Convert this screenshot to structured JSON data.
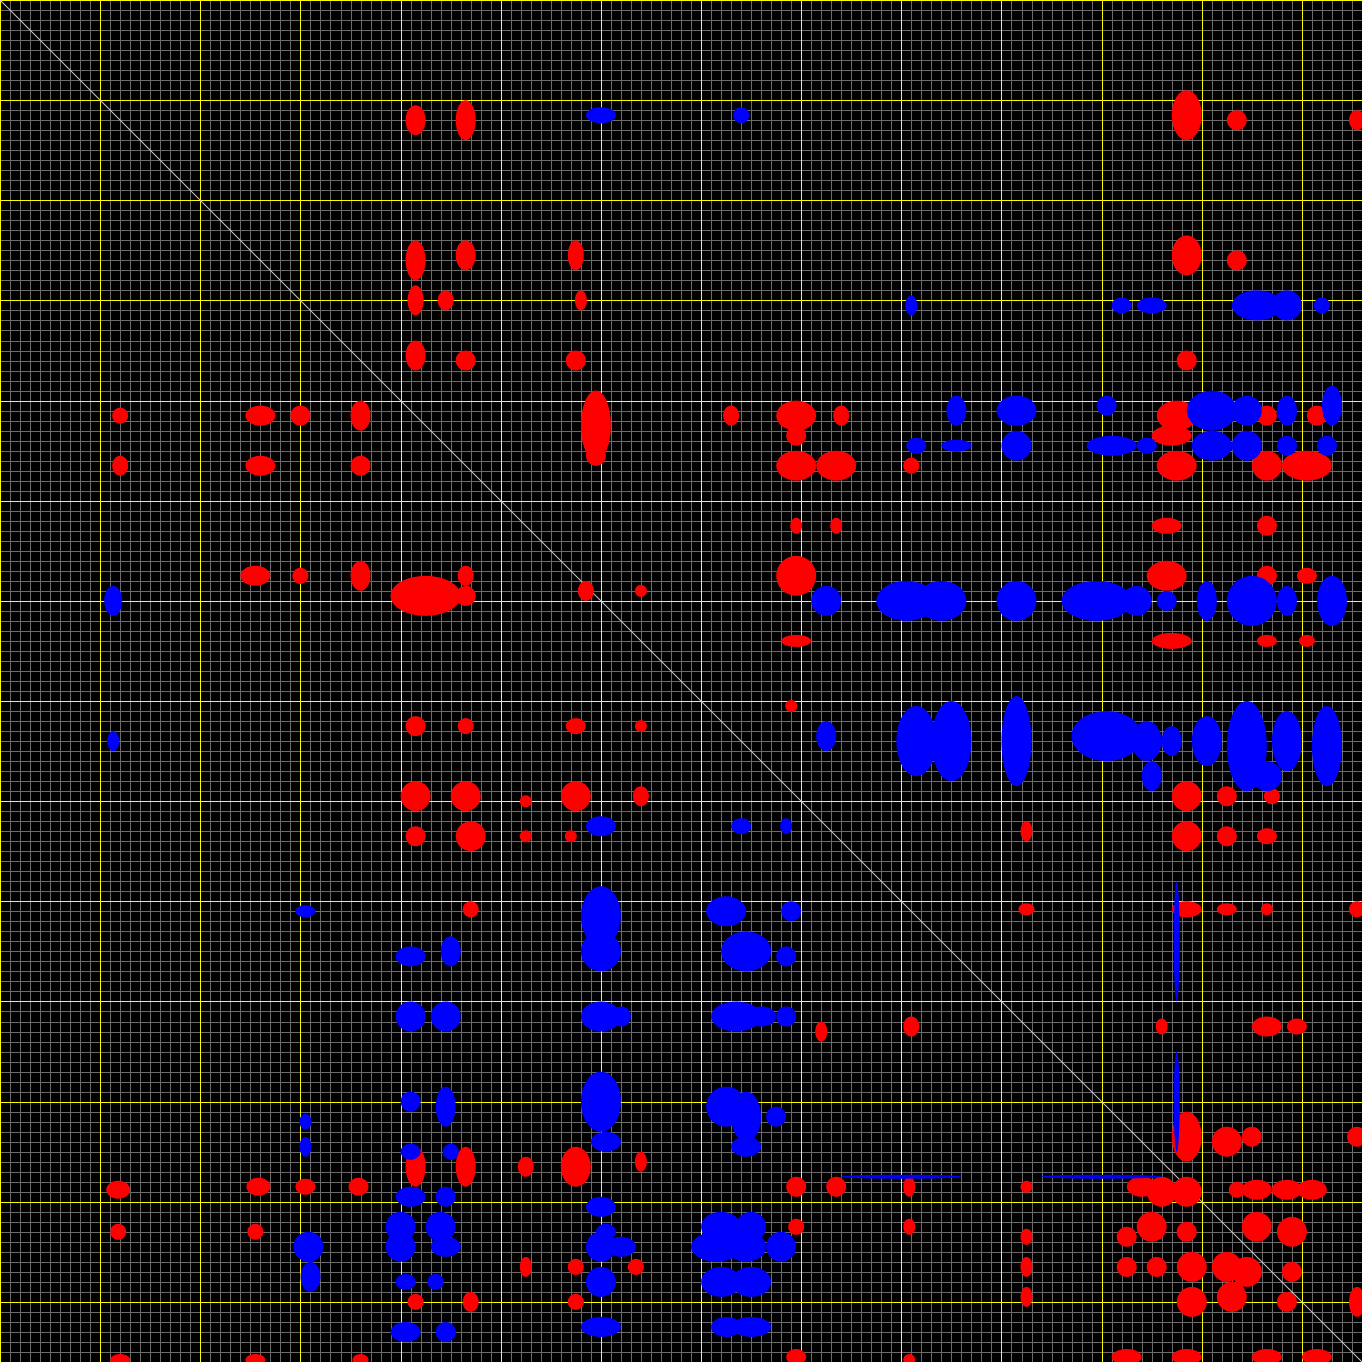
{
  "map": {
    "bins": 136,
    "diagonal": true,
    "grid": {
      "minor_every": 1,
      "major_every": 10
    },
    "colors": {
      "background": "#000000",
      "minor_grid": "#6b6b6b",
      "major_grid": "#ffff00",
      "diagonal": "#c8c8c8",
      "positive": "#ff0000",
      "negative": "#0000ff"
    }
  },
  "blocks": {
    "positive": [
      [
        46.5,
        12.0,
        1.0,
        2.0
      ],
      [
        41.5,
        12.0,
        1.0,
        1.5
      ],
      [
        118.5,
        11.5,
        1.5,
        2.5
      ],
      [
        123.5,
        12.0,
        1.0,
        1.0
      ],
      [
        135.5,
        12.0,
        0.8,
        1.0
      ],
      [
        41.5,
        26.0,
        1.0,
        2.0
      ],
      [
        46.5,
        25.5,
        1.0,
        1.5
      ],
      [
        57.5,
        25.5,
        0.8,
        1.5
      ],
      [
        118.5,
        25.5,
        1.5,
        2.0
      ],
      [
        123.5,
        26.0,
        1.0,
        1.0
      ],
      [
        41.5,
        30.0,
        0.8,
        1.5
      ],
      [
        44.5,
        30.0,
        0.8,
        1.0
      ],
      [
        58.0,
        30.0,
        0.6,
        1.0
      ],
      [
        41.5,
        35.5,
        1.0,
        1.5
      ],
      [
        46.5,
        36.0,
        1.0,
        1.0
      ],
      [
        57.5,
        36.0,
        1.0,
        1.0
      ],
      [
        118.5,
        36.0,
        1.0,
        1.0
      ],
      [
        12.0,
        41.5,
        0.8,
        0.8
      ],
      [
        26.0,
        41.5,
        1.5,
        1.0
      ],
      [
        30.0,
        41.5,
        1.0,
        1.0
      ],
      [
        36.0,
        41.5,
        1.0,
        1.5
      ],
      [
        59.5,
        42.5,
        1.5,
        3.5
      ],
      [
        73.0,
        41.5,
        0.8,
        1.0
      ],
      [
        79.5,
        41.5,
        2.0,
        1.5
      ],
      [
        84.0,
        41.5,
        0.8,
        1.0
      ],
      [
        117.5,
        41.5,
        2.0,
        1.5
      ],
      [
        122.0,
        41.5,
        1.0,
        1.0
      ],
      [
        126.5,
        41.5,
        1.0,
        1.0
      ],
      [
        131.5,
        41.5,
        1.0,
        1.0
      ],
      [
        79.5,
        43.5,
        1.0,
        1.0
      ],
      [
        117.0,
        43.5,
        2.0,
        1.0
      ],
      [
        12.0,
        46.5,
        0.8,
        1.0
      ],
      [
        26.0,
        46.5,
        1.5,
        1.0
      ],
      [
        36.0,
        46.5,
        1.0,
        1.0
      ],
      [
        59.5,
        45.5,
        1.0,
        1.0
      ],
      [
        79.5,
        46.5,
        2.0,
        1.5
      ],
      [
        83.5,
        46.5,
        2.0,
        1.5
      ],
      [
        91.0,
        46.5,
        0.8,
        0.8
      ],
      [
        117.5,
        46.5,
        2.0,
        1.5
      ],
      [
        126.5,
        46.5,
        1.5,
        1.5
      ],
      [
        130.5,
        46.5,
        2.5,
        1.5
      ],
      [
        79.5,
        52.5,
        0.6,
        0.8
      ],
      [
        83.5,
        52.5,
        0.6,
        0.8
      ],
      [
        116.5,
        52.5,
        1.5,
        0.8
      ],
      [
        126.5,
        52.5,
        1.0,
        1.0
      ],
      [
        25.5,
        57.5,
        1.5,
        1.0
      ],
      [
        36.0,
        57.5,
        1.0,
        1.5
      ],
      [
        30.0,
        57.5,
        0.8,
        0.8
      ],
      [
        46.5,
        57.5,
        0.8,
        1.0
      ],
      [
        79.5,
        57.5,
        2.0,
        2.0
      ],
      [
        116.5,
        57.5,
        2.0,
        1.5
      ],
      [
        126.5,
        57.5,
        1.0,
        1.0
      ],
      [
        130.5,
        57.5,
        1.0,
        0.8
      ],
      [
        42.5,
        59.5,
        3.5,
        2.0
      ],
      [
        46.5,
        59.5,
        1.0,
        1.0
      ],
      [
        58.5,
        59.0,
        0.8,
        1.0
      ],
      [
        64.0,
        59.0,
        0.6,
        0.6
      ],
      [
        79.5,
        64.0,
        1.5,
        0.6
      ],
      [
        117.0,
        64.0,
        2.0,
        0.8
      ],
      [
        126.5,
        64.0,
        1.0,
        0.6
      ],
      [
        130.5,
        64.0,
        0.8,
        0.6
      ],
      [
        41.5,
        72.5,
        1.0,
        1.0
      ],
      [
        46.5,
        72.5,
        0.8,
        0.8
      ],
      [
        57.5,
        72.5,
        1.0,
        0.8
      ],
      [
        64.0,
        72.5,
        0.6,
        0.6
      ],
      [
        79.0,
        70.5,
        0.6,
        0.6
      ],
      [
        41.5,
        79.5,
        1.5,
        1.5
      ],
      [
        46.5,
        79.5,
        1.5,
        1.5
      ],
      [
        57.5,
        79.5,
        1.5,
        1.5
      ],
      [
        64.0,
        79.5,
        0.8,
        1.0
      ],
      [
        52.5,
        80.0,
        0.6,
        0.6
      ],
      [
        118.5,
        79.5,
        1.5,
        1.5
      ],
      [
        122.5,
        79.5,
        1.0,
        1.0
      ],
      [
        127.0,
        79.5,
        0.8,
        0.8
      ],
      [
        41.5,
        83.5,
        1.0,
        1.0
      ],
      [
        47.0,
        83.5,
        1.5,
        1.5
      ],
      [
        52.5,
        83.5,
        0.6,
        0.6
      ],
      [
        57.0,
        83.5,
        0.6,
        0.6
      ],
      [
        118.5,
        83.5,
        1.5,
        1.5
      ],
      [
        122.5,
        83.5,
        1.0,
        1.0
      ],
      [
        126.5,
        83.5,
        1.0,
        0.8
      ],
      [
        102.5,
        83.0,
        0.6,
        1.0
      ],
      [
        47.0,
        90.8,
        0.8,
        0.8
      ],
      [
        102.5,
        90.8,
        0.8,
        0.6
      ],
      [
        118.5,
        90.8,
        1.5,
        0.8
      ],
      [
        122.5,
        90.8,
        1.0,
        0.6
      ],
      [
        126.5,
        90.8,
        0.6,
        0.6
      ],
      [
        135.5,
        90.8,
        0.8,
        0.8
      ],
      [
        82.0,
        103.0,
        0.6,
        1.0
      ],
      [
        91.0,
        102.5,
        0.8,
        1.0
      ],
      [
        116.0,
        102.5,
        0.6,
        0.8
      ],
      [
        126.5,
        102.5,
        1.5,
        1.0
      ],
      [
        129.5,
        102.5,
        1.0,
        0.8
      ],
      [
        41.5,
        116.5,
        1.0,
        2.0
      ],
      [
        46.5,
        116.5,
        1.0,
        2.0
      ],
      [
        52.5,
        116.5,
        0.8,
        1.0
      ],
      [
        57.5,
        116.5,
        1.5,
        2.0
      ],
      [
        64.0,
        116.0,
        0.6,
        1.0
      ],
      [
        118.5,
        113.5,
        1.5,
        2.5
      ],
      [
        122.5,
        114.0,
        1.5,
        1.5
      ],
      [
        125.0,
        113.5,
        1.0,
        1.0
      ],
      [
        135.5,
        113.5,
        1.0,
        1.0
      ],
      [
        11.8,
        118.8,
        1.2,
        0.9
      ],
      [
        25.8,
        118.5,
        1.2,
        0.9
      ],
      [
        30.5,
        118.5,
        1.0,
        0.8
      ],
      [
        35.8,
        118.5,
        1.0,
        0.9
      ],
      [
        79.5,
        118.5,
        1.0,
        1.0
      ],
      [
        83.5,
        118.5,
        1.0,
        1.0
      ],
      [
        90.8,
        118.5,
        0.6,
        1.0
      ],
      [
        102.5,
        118.5,
        0.6,
        0.6
      ],
      [
        114.0,
        118.5,
        1.5,
        1.0
      ],
      [
        116.0,
        119.0,
        1.5,
        1.5
      ],
      [
        118.5,
        119.0,
        1.5,
        1.5
      ],
      [
        123.5,
        118.8,
        0.8,
        0.8
      ],
      [
        125.5,
        118.8,
        1.5,
        1.0
      ],
      [
        128.5,
        118.8,
        1.5,
        1.0
      ],
      [
        131.0,
        118.8,
        1.5,
        1.0
      ],
      [
        11.8,
        123.0,
        0.8,
        0.8
      ],
      [
        25.5,
        123.0,
        0.8,
        0.8
      ],
      [
        79.5,
        122.5,
        0.8,
        0.8
      ],
      [
        90.8,
        122.5,
        0.6,
        0.8
      ],
      [
        102.5,
        123.5,
        0.6,
        0.8
      ],
      [
        112.5,
        123.5,
        1.0,
        1.0
      ],
      [
        115.0,
        122.5,
        1.5,
        1.5
      ],
      [
        118.5,
        123.0,
        1.0,
        1.0
      ],
      [
        125.5,
        122.5,
        1.5,
        1.5
      ],
      [
        129.0,
        123.0,
        1.5,
        1.5
      ],
      [
        52.5,
        126.5,
        0.6,
        1.0
      ],
      [
        57.5,
        126.5,
        0.8,
        0.8
      ],
      [
        63.5,
        126.5,
        0.8,
        0.8
      ],
      [
        102.5,
        126.5,
        0.6,
        1.0
      ],
      [
        112.5,
        126.5,
        1.0,
        1.0
      ],
      [
        115.5,
        126.5,
        1.0,
        1.0
      ],
      [
        119.0,
        126.5,
        1.5,
        1.5
      ],
      [
        122.5,
        126.5,
        1.5,
        1.5
      ],
      [
        124.5,
        127.0,
        1.5,
        1.5
      ],
      [
        129.0,
        127.0,
        1.0,
        1.0
      ],
      [
        41.5,
        130.0,
        0.8,
        0.8
      ],
      [
        47.0,
        130.0,
        0.8,
        1.0
      ],
      [
        57.5,
        130.0,
        0.8,
        0.8
      ],
      [
        102.5,
        129.5,
        0.6,
        1.0
      ],
      [
        119.0,
        130.0,
        1.5,
        1.5
      ],
      [
        123.0,
        129.5,
        1.5,
        1.5
      ],
      [
        128.5,
        130.0,
        1.0,
        1.0
      ],
      [
        135.5,
        130.0,
        0.8,
        1.5
      ],
      [
        12.0,
        135.8,
        1.0,
        0.6
      ],
      [
        25.5,
        135.8,
        1.0,
        0.6
      ],
      [
        36.0,
        135.8,
        0.8,
        0.6
      ],
      [
        79.5,
        135.5,
        1.0,
        0.8
      ],
      [
        90.8,
        135.8,
        0.6,
        0.6
      ],
      [
        112.5,
        135.5,
        1.5,
        0.8
      ],
      [
        118.5,
        135.5,
        1.5,
        0.8
      ],
      [
        126.5,
        135.5,
        1.5,
        0.8
      ],
      [
        131.5,
        135.5,
        1.5,
        0.8
      ]
    ],
    "negative": [
      [
        60.0,
        11.5,
        1.5,
        0.8
      ],
      [
        74.0,
        11.5,
        0.8,
        0.8
      ],
      [
        91.0,
        30.5,
        0.6,
        1.0
      ],
      [
        112.0,
        30.5,
        1.0,
        0.8
      ],
      [
        115.0,
        30.5,
        1.5,
        0.8
      ],
      [
        125.5,
        30.5,
        2.5,
        1.5
      ],
      [
        128.5,
        30.5,
        1.5,
        1.5
      ],
      [
        132.0,
        30.5,
        0.8,
        0.8
      ],
      [
        95.5,
        41.0,
        1.0,
        1.5
      ],
      [
        101.5,
        41.0,
        2.0,
        1.5
      ],
      [
        110.5,
        40.5,
        1.0,
        1.0
      ],
      [
        121.0,
        41.0,
        2.5,
        2.0
      ],
      [
        124.5,
        41.0,
        1.5,
        1.5
      ],
      [
        128.5,
        41.0,
        1.0,
        1.5
      ],
      [
        133.0,
        40.5,
        1.0,
        2.0
      ],
      [
        91.5,
        44.5,
        1.0,
        0.8
      ],
      [
        95.5,
        44.5,
        1.5,
        0.6
      ],
      [
        101.5,
        44.5,
        1.5,
        1.5
      ],
      [
        111.0,
        44.5,
        2.5,
        1.0
      ],
      [
        114.5,
        44.5,
        1.0,
        0.8
      ],
      [
        121.0,
        44.5,
        2.0,
        1.5
      ],
      [
        124.5,
        44.5,
        1.5,
        1.5
      ],
      [
        128.5,
        44.5,
        1.0,
        1.0
      ],
      [
        132.5,
        44.5,
        1.0,
        1.0
      ],
      [
        11.3,
        60.0,
        0.9,
        1.5
      ],
      [
        82.5,
        60.0,
        1.5,
        1.5
      ],
      [
        90.5,
        60.0,
        3.0,
        2.0
      ],
      [
        94.0,
        60.0,
        2.5,
        2.0
      ],
      [
        101.5,
        60.0,
        2.0,
        2.0
      ],
      [
        109.5,
        60.0,
        3.5,
        2.0
      ],
      [
        113.5,
        60.0,
        1.5,
        1.5
      ],
      [
        116.5,
        60.0,
        1.0,
        1.0
      ],
      [
        120.5,
        60.0,
        1.0,
        2.0
      ],
      [
        125.0,
        60.0,
        2.5,
        2.5
      ],
      [
        128.5,
        60.0,
        1.0,
        1.5
      ],
      [
        133.0,
        60.0,
        1.5,
        2.5
      ],
      [
        11.3,
        74.0,
        0.6,
        1.0
      ],
      [
        82.5,
        73.5,
        1.0,
        1.5
      ],
      [
        91.5,
        74.0,
        2.0,
        3.5
      ],
      [
        95.0,
        74.0,
        2.0,
        4.0
      ],
      [
        101.5,
        74.0,
        1.5,
        4.5
      ],
      [
        110.5,
        73.5,
        3.5,
        2.5
      ],
      [
        114.5,
        74.0,
        1.5,
        2.0
      ],
      [
        117.0,
        74.0,
        1.0,
        1.5
      ],
      [
        120.5,
        74.0,
        1.5,
        2.5
      ],
      [
        124.5,
        74.5,
        2.0,
        4.5
      ],
      [
        128.5,
        74.0,
        1.5,
        3.0
      ],
      [
        132.5,
        74.5,
        1.5,
        4.0
      ],
      [
        115.0,
        77.5,
        1.0,
        1.5
      ],
      [
        126.5,
        77.5,
        1.5,
        1.5
      ],
      [
        60.0,
        82.5,
        1.5,
        1.0
      ],
      [
        74.0,
        82.5,
        1.0,
        0.8
      ],
      [
        78.5,
        82.5,
        0.6,
        0.8
      ],
      [
        30.5,
        91.0,
        1.0,
        0.6
      ],
      [
        41.0,
        95.5,
        1.5,
        1.0
      ],
      [
        45.0,
        95.0,
        1.0,
        1.5
      ],
      [
        60.0,
        91.5,
        2.0,
        3.0
      ],
      [
        60.0,
        95.0,
        2.0,
        2.0
      ],
      [
        72.5,
        91.0,
        2.0,
        1.5
      ],
      [
        74.5,
        95.0,
        2.5,
        2.0
      ],
      [
        79.0,
        91.0,
        1.0,
        1.0
      ],
      [
        78.5,
        95.5,
        1.0,
        1.0
      ],
      [
        41.0,
        101.5,
        1.5,
        1.5
      ],
      [
        44.5,
        101.5,
        1.5,
        1.5
      ],
      [
        60.0,
        101.5,
        2.0,
        1.5
      ],
      [
        62.0,
        101.5,
        1.0,
        1.0
      ],
      [
        73.5,
        101.5,
        2.5,
        1.5
      ],
      [
        76.0,
        101.5,
        1.5,
        1.0
      ],
      [
        78.5,
        101.5,
        1.0,
        1.0
      ],
      [
        30.5,
        112.0,
        0.6,
        0.8
      ],
      [
        41.0,
        110.0,
        1.0,
        1.0
      ],
      [
        44.5,
        110.5,
        1.0,
        2.0
      ],
      [
        60.0,
        110.0,
        2.0,
        3.0
      ],
      [
        60.5,
        114.0,
        1.5,
        1.0
      ],
      [
        72.5,
        110.5,
        2.0,
        2.0
      ],
      [
        74.5,
        111.5,
        1.5,
        2.5
      ],
      [
        77.5,
        111.5,
        1.0,
        1.0
      ],
      [
        74.5,
        114.5,
        1.5,
        1.0
      ],
      [
        30.5,
        114.5,
        0.6,
        1.0
      ],
      [
        41.0,
        115.0,
        1.0,
        0.8
      ],
      [
        45.0,
        115.0,
        0.8,
        0.8
      ],
      [
        41.0,
        119.5,
        1.5,
        1.0
      ],
      [
        44.5,
        119.5,
        1.0,
        1.0
      ],
      [
        60.0,
        120.5,
        1.5,
        1.0
      ],
      [
        60.5,
        123.0,
        1.0,
        0.8
      ],
      [
        40.0,
        122.5,
        1.5,
        1.5
      ],
      [
        44.0,
        122.5,
        1.5,
        1.5
      ],
      [
        72.0,
        122.5,
        2.0,
        1.5
      ],
      [
        75.0,
        122.5,
        1.5,
        1.5
      ],
      [
        30.8,
        124.5,
        1.5,
        1.5
      ],
      [
        40.0,
        124.5,
        1.5,
        1.5
      ],
      [
        44.5,
        124.5,
        1.5,
        1.0
      ],
      [
        60.0,
        124.5,
        1.5,
        1.5
      ],
      [
        62.0,
        124.5,
        1.5,
        1.0
      ],
      [
        71.5,
        124.5,
        2.5,
        1.5
      ],
      [
        74.5,
        124.5,
        2.0,
        1.5
      ],
      [
        78.0,
        124.5,
        1.5,
        1.5
      ],
      [
        31.0,
        127.5,
        1.0,
        1.5
      ],
      [
        40.5,
        128.0,
        1.0,
        0.8
      ],
      [
        43.5,
        128.0,
        0.8,
        0.8
      ],
      [
        60.0,
        128.0,
        1.5,
        1.5
      ],
      [
        72.0,
        128.0,
        2.0,
        1.5
      ],
      [
        75.0,
        128.0,
        2.0,
        1.5
      ],
      [
        40.5,
        133.0,
        1.5,
        1.0
      ],
      [
        44.5,
        133.0,
        1.0,
        1.0
      ],
      [
        60.0,
        132.5,
        2.0,
        1.0
      ],
      [
        72.5,
        132.5,
        1.5,
        1.0
      ],
      [
        75.0,
        132.5,
        2.0,
        1.0
      ],
      [
        117.5,
        94.0,
        0.3,
        6.0
      ],
      [
        117.5,
        110.0,
        0.3,
        5.0
      ],
      [
        90.0,
        117.5,
        6.0,
        0.2
      ],
      [
        110.0,
        117.5,
        6.0,
        0.2
      ]
    ]
  }
}
